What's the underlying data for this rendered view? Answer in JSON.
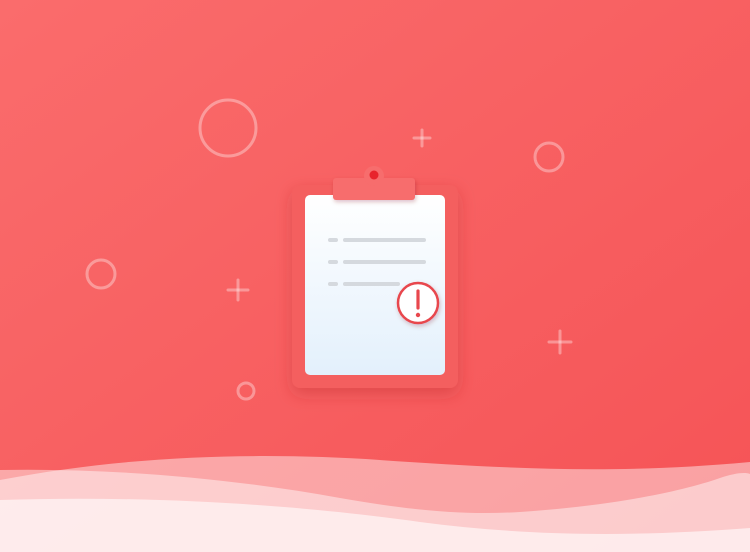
{
  "illustration": {
    "subject": "clipboard-with-warning",
    "icons": [
      "clipboard-icon",
      "warning-icon"
    ],
    "colors": {
      "background_start": "#fa6c6c",
      "background_end": "#f55356",
      "clipboard_body": "#f45e5e",
      "clipboard_clip": "#f76d6d",
      "clip_dot": "#e8242c",
      "paper_top": "#ffffff",
      "paper_bottom": "#e3f0fc",
      "text_lines": "#d5d9de",
      "warning": "#e8474d",
      "deco": "#ffffff"
    }
  }
}
